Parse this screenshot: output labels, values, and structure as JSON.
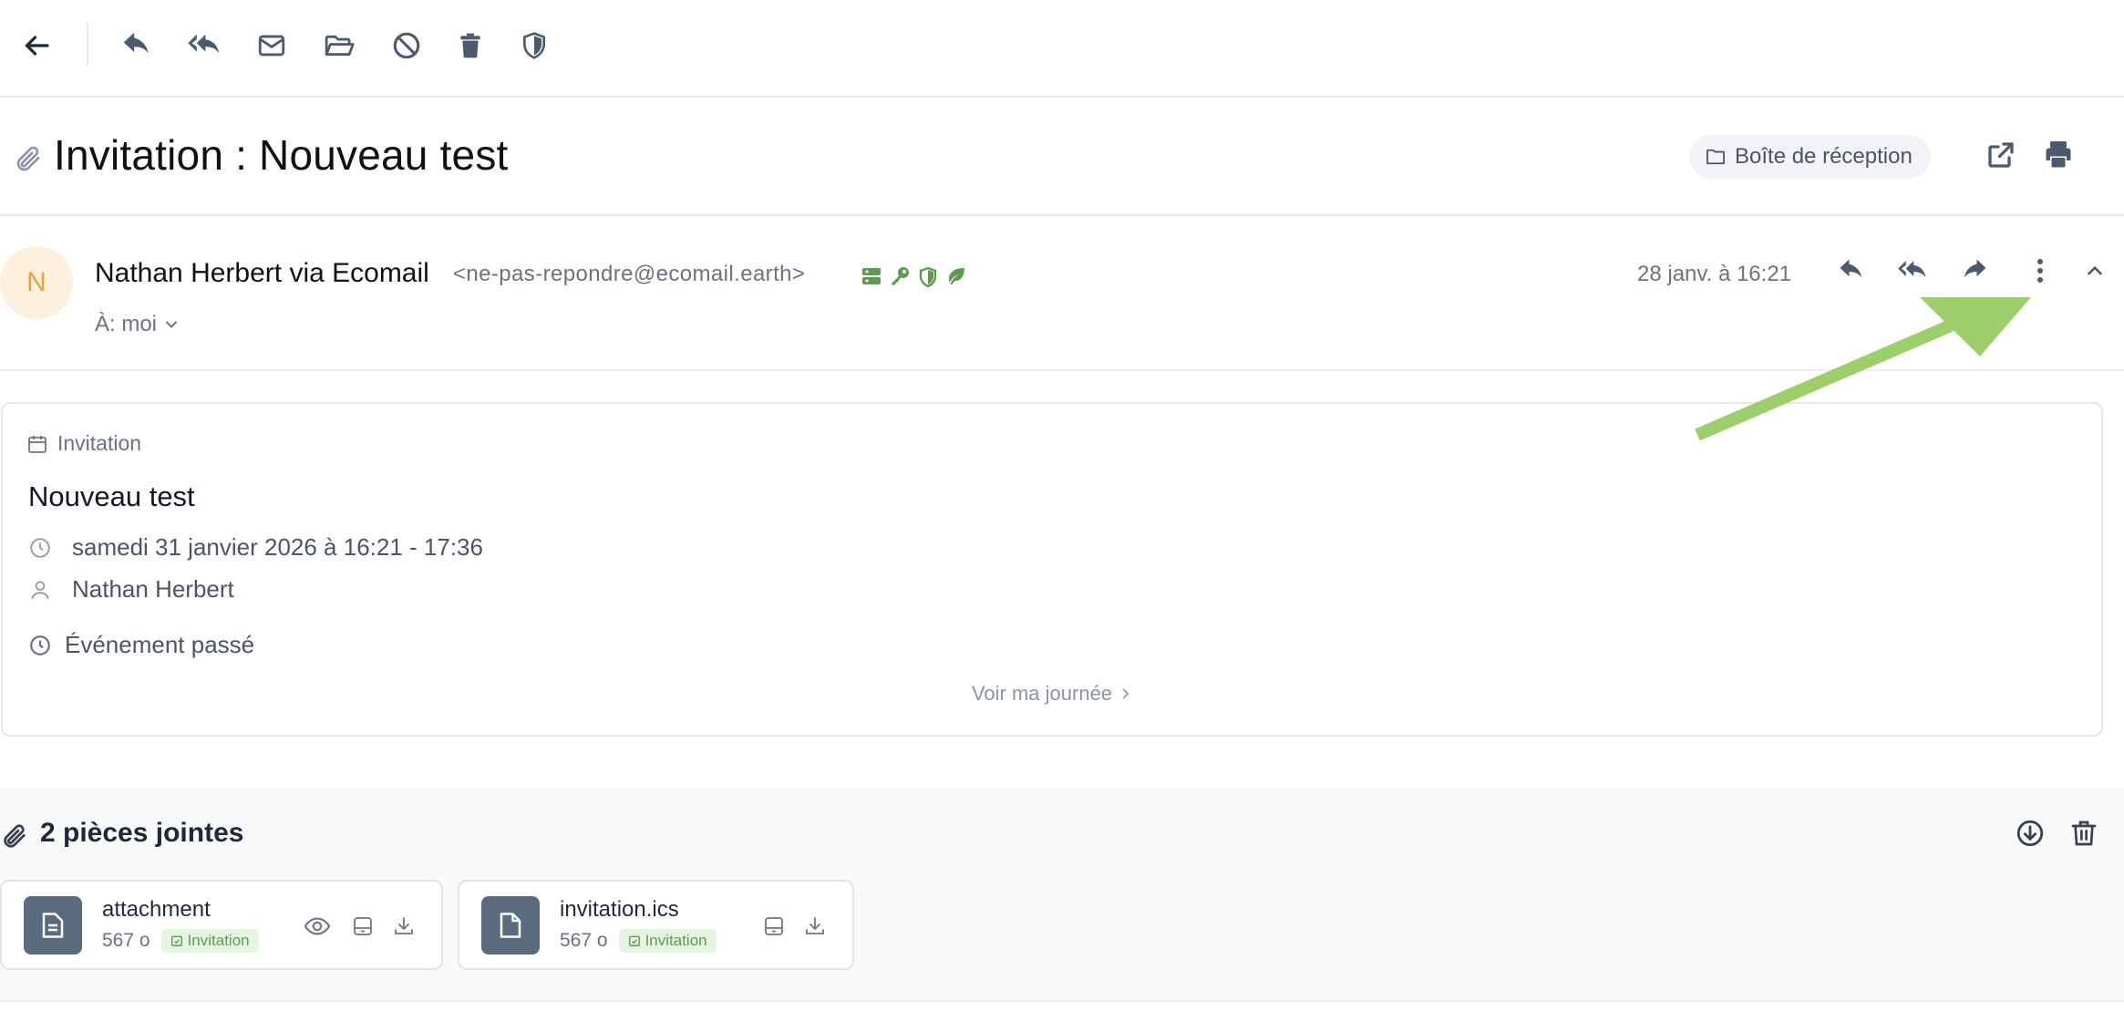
{
  "toolbar": {
    "buttons": [
      "back-arrow-icon",
      "reply-icon",
      "reply-all-icon",
      "mail-icon",
      "folder-open-icon",
      "ban-icon",
      "trash-icon",
      "shield-icon"
    ]
  },
  "subject": {
    "title": "Invitation : Nouveau test",
    "folder_label": "Boîte de réception"
  },
  "message": {
    "avatar_letter": "N",
    "sender_name": "Nathan Herbert via Ecomail",
    "sender_email": "<ne-pas-repondre@ecomail.earth>",
    "to_label": "À: moi",
    "date": "28 janv. à 16:21",
    "security_icons": [
      "server-icon",
      "key-icon",
      "shield-icon",
      "leaf-icon"
    ],
    "security_color": "#5d9c50"
  },
  "invitation": {
    "type_label": "Invitation",
    "title": "Nouveau test",
    "datetime": "samedi 31 janvier 2026 à 16:21 - 17:36",
    "organizer": "Nathan Herbert",
    "status": "Événement passé",
    "link_label": "Voir ma journée"
  },
  "attachments": {
    "title": "2 pièces jointes",
    "items": [
      {
        "name": "attachment",
        "size": "567 o",
        "badge": "Invitation"
      },
      {
        "name": "invitation.ics",
        "size": "567 o",
        "badge": "Invitation"
      }
    ]
  },
  "colors": {
    "annotation_arrow": "#9ccf6a",
    "accent_green": "#5d9c50",
    "icon_gray": "#4b5a6e"
  }
}
